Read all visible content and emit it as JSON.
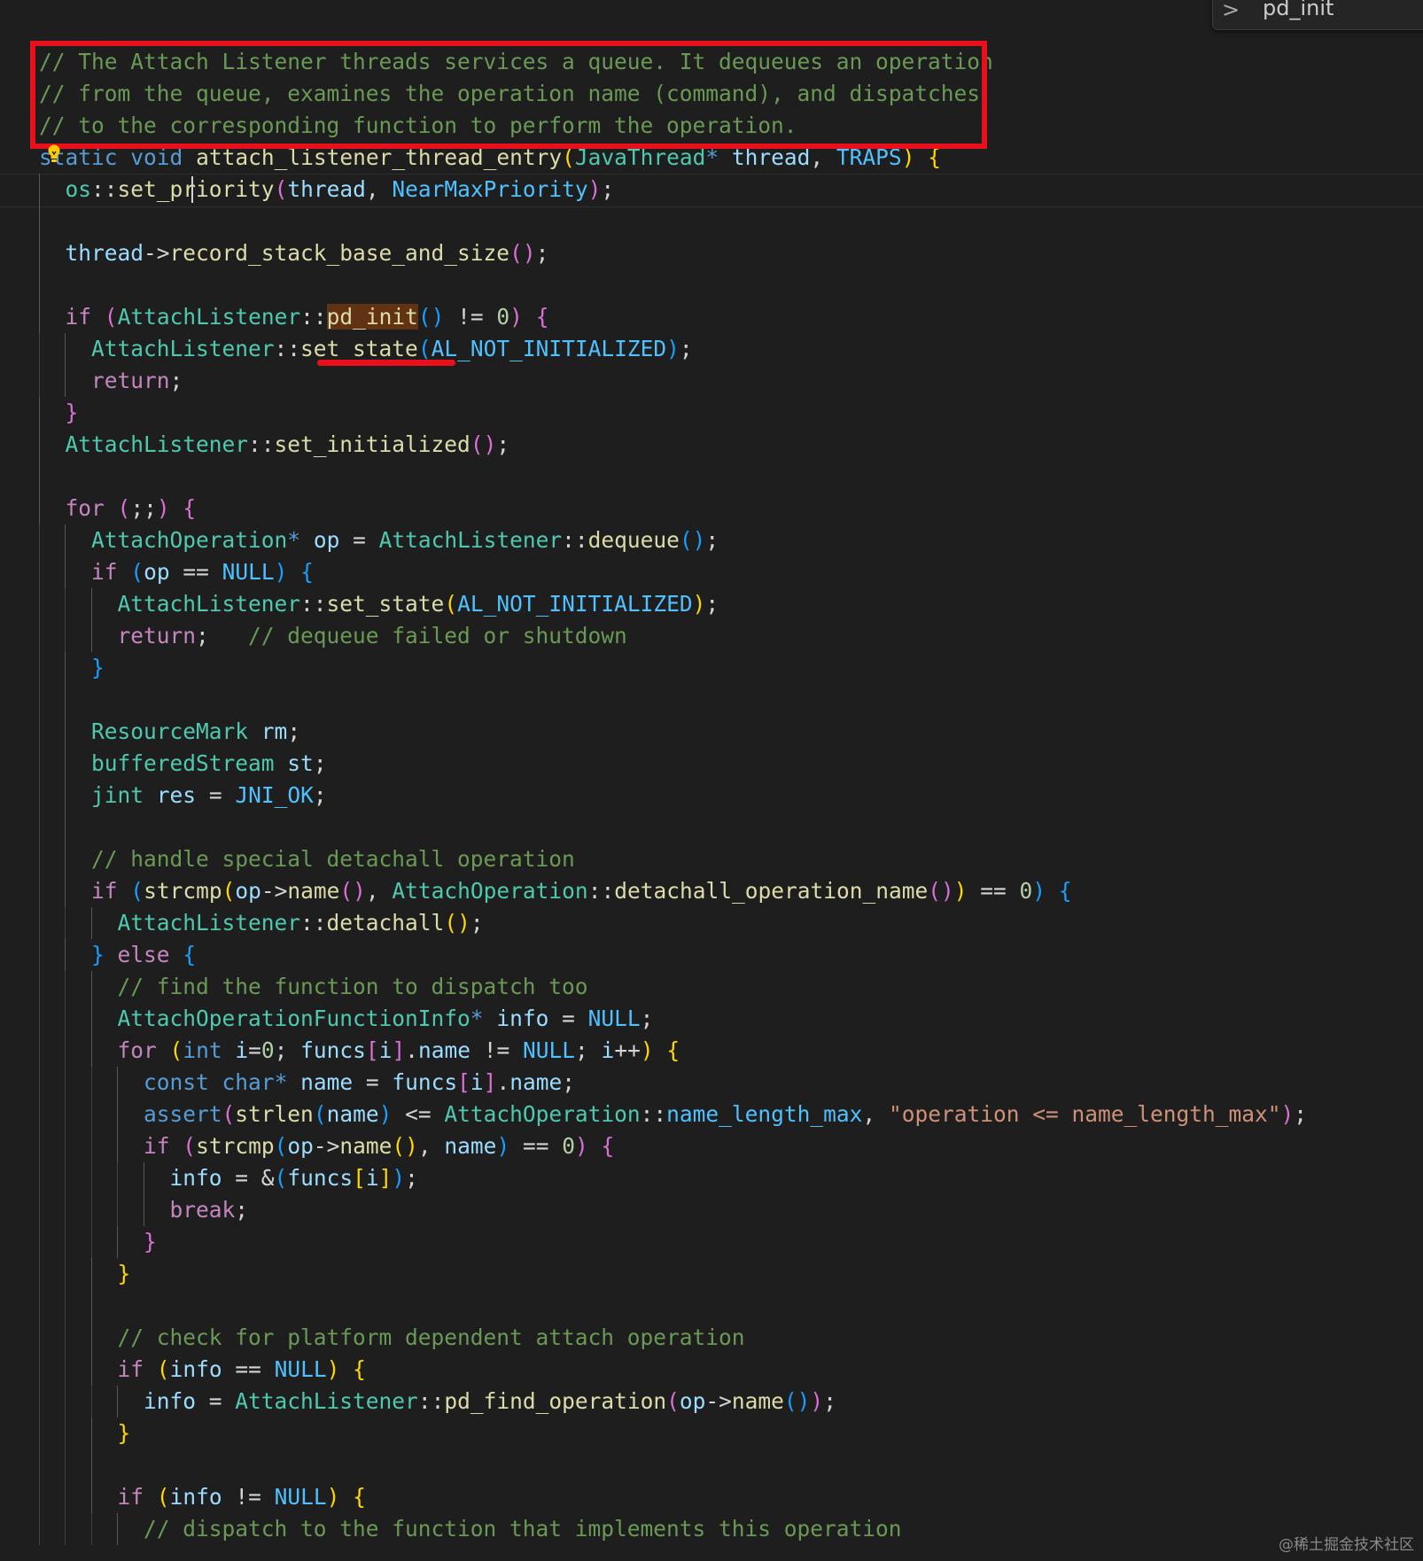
{
  "find_widget": {
    "search_term": "pd_init",
    "chevron": ">"
  },
  "watermark": "@稀土掘金技术社区",
  "annotation_colors": {
    "box": "#e8101a",
    "underline": "#e8101a"
  },
  "code_lines": [
    "// The Attach Listener threads services a queue. It dequeues an operation",
    "// from the queue, examines the operation name (command), and dispatches",
    "// to the corresponding function to perform the operation.",
    "static void attach_listener_thread_entry(JavaThread* thread, TRAPS) {",
    "  os::set_priority(thread, NearMaxPriority);",
    "",
    "  thread->record_stack_base_and_size();",
    "",
    "  if (AttachListener::pd_init() != 0) {",
    "    AttachListener::set_state(AL_NOT_INITIALIZED);",
    "    return;",
    "  }",
    "  AttachListener::set_initialized();",
    "",
    "  for (;;) {",
    "    AttachOperation* op = AttachListener::dequeue();",
    "    if (op == NULL) {",
    "      AttachListener::set_state(AL_NOT_INITIALIZED);",
    "      return;   // dequeue failed or shutdown",
    "    }",
    "",
    "    ResourceMark rm;",
    "    bufferedStream st;",
    "    jint res = JNI_OK;",
    "",
    "    // handle special detachall operation",
    "    if (strcmp(op->name(), AttachOperation::detachall_operation_name()) == 0) {",
    "      AttachListener::detachall();",
    "    } else {",
    "      // find the function to dispatch too",
    "      AttachOperationFunctionInfo* info = NULL;",
    "      for (int i=0; funcs[i].name != NULL; i++) {",
    "        const char* name = funcs[i].name;",
    "        assert(strlen(name) <= AttachOperation::name_length_max, \"operation <= name_length_max\");",
    "        if (strcmp(op->name(), name) == 0) {",
    "          info = &(funcs[i]);",
    "          break;",
    "        }",
    "      }",
    "",
    "      // check for platform dependent attach operation",
    "      if (info == NULL) {",
    "        info = AttachListener::pd_find_operation(op->name());",
    "      }",
    "",
    "      if (info != NULL) {",
    "        // dispatch to the function that implements this operation"
  ],
  "tokens": [
    [
      [
        "c",
        "// The Attach Listener threads services a queue. It dequeues an operation"
      ]
    ],
    [
      [
        "c",
        "// from the queue, examines the operation name (command), and dispatches"
      ]
    ],
    [
      [
        "c",
        "// to the corresponding function to perform the operation."
      ]
    ],
    [
      [
        "k",
        "static"
      ],
      [
        "p",
        " "
      ],
      [
        "k",
        "void"
      ],
      [
        "p",
        " "
      ],
      [
        "f",
        "attach_listener_thread_entry"
      ],
      [
        "b1",
        "("
      ],
      [
        "t",
        "JavaThread"
      ],
      [
        "k",
        "*"
      ],
      [
        "p",
        " "
      ],
      [
        "v",
        "thread"
      ],
      [
        "p",
        ", "
      ],
      [
        "cn",
        "TRAPS"
      ],
      [
        "b1",
        ")"
      ],
      [
        "p",
        " "
      ],
      [
        "b1",
        "{"
      ]
    ],
    [
      [
        "p",
        "  "
      ],
      [
        "t",
        "os"
      ],
      [
        "p",
        "::"
      ],
      [
        "f",
        "set_priority"
      ],
      [
        "b2",
        "("
      ],
      [
        "v",
        "thread"
      ],
      [
        "p",
        ", "
      ],
      [
        "cn",
        "NearMaxPriority"
      ],
      [
        "b2",
        ")"
      ],
      [
        "p",
        ";"
      ]
    ],
    [],
    [
      [
        "p",
        "  "
      ],
      [
        "v",
        "thread"
      ],
      [
        "p",
        "->"
      ],
      [
        "f",
        "record_stack_base_and_size"
      ],
      [
        "b2",
        "()"
      ],
      [
        "p",
        ";"
      ]
    ],
    [],
    [
      [
        "p",
        "  "
      ],
      [
        "kc",
        "if"
      ],
      [
        "p",
        " "
      ],
      [
        "b2",
        "("
      ],
      [
        "t",
        "AttachListener"
      ],
      [
        "p",
        "::"
      ],
      [
        "fh",
        "pd_init"
      ],
      [
        "b3",
        "()"
      ],
      [
        "p",
        " != "
      ],
      [
        "n",
        "0"
      ],
      [
        "b2",
        ")"
      ],
      [
        "p",
        " "
      ],
      [
        "b2",
        "{"
      ]
    ],
    [
      [
        "p",
        "    "
      ],
      [
        "t",
        "AttachListener"
      ],
      [
        "p",
        "::"
      ],
      [
        "f",
        "set_state"
      ],
      [
        "b3",
        "("
      ],
      [
        "cn",
        "AL_NOT_INITIALIZED"
      ],
      [
        "b3",
        ")"
      ],
      [
        "p",
        ";"
      ]
    ],
    [
      [
        "p",
        "    "
      ],
      [
        "kc",
        "return"
      ],
      [
        "p",
        ";"
      ]
    ],
    [
      [
        "p",
        "  "
      ],
      [
        "b2",
        "}"
      ]
    ],
    [
      [
        "p",
        "  "
      ],
      [
        "t",
        "AttachListener"
      ],
      [
        "p",
        "::"
      ],
      [
        "f",
        "set_initialized"
      ],
      [
        "b2",
        "()"
      ],
      [
        "p",
        ";"
      ]
    ],
    [],
    [
      [
        "p",
        "  "
      ],
      [
        "kc",
        "for"
      ],
      [
        "p",
        " "
      ],
      [
        "b2",
        "("
      ],
      [
        "p",
        ";;"
      ],
      [
        "b2",
        ")"
      ],
      [
        "p",
        " "
      ],
      [
        "b2",
        "{"
      ]
    ],
    [
      [
        "p",
        "    "
      ],
      [
        "t",
        "AttachOperation"
      ],
      [
        "k",
        "*"
      ],
      [
        "p",
        " "
      ],
      [
        "v",
        "op"
      ],
      [
        "p",
        " = "
      ],
      [
        "t",
        "AttachListener"
      ],
      [
        "p",
        "::"
      ],
      [
        "f",
        "dequeue"
      ],
      [
        "b3",
        "()"
      ],
      [
        "p",
        ";"
      ]
    ],
    [
      [
        "p",
        "    "
      ],
      [
        "kc",
        "if"
      ],
      [
        "p",
        " "
      ],
      [
        "b3",
        "("
      ],
      [
        "v",
        "op"
      ],
      [
        "p",
        " == "
      ],
      [
        "cn",
        "NULL"
      ],
      [
        "b3",
        ")"
      ],
      [
        "p",
        " "
      ],
      [
        "b3",
        "{"
      ]
    ],
    [
      [
        "p",
        "      "
      ],
      [
        "t",
        "AttachListener"
      ],
      [
        "p",
        "::"
      ],
      [
        "f",
        "set_state"
      ],
      [
        "b1",
        "("
      ],
      [
        "cn",
        "AL_NOT_INITIALIZED"
      ],
      [
        "b1",
        ")"
      ],
      [
        "p",
        ";"
      ]
    ],
    [
      [
        "p",
        "      "
      ],
      [
        "kc",
        "return"
      ],
      [
        "p",
        ";   "
      ],
      [
        "c",
        "// dequeue failed or shutdown"
      ]
    ],
    [
      [
        "p",
        "    "
      ],
      [
        "b3",
        "}"
      ]
    ],
    [],
    [
      [
        "p",
        "    "
      ],
      [
        "t",
        "ResourceMark"
      ],
      [
        "p",
        " "
      ],
      [
        "v",
        "rm"
      ],
      [
        "p",
        ";"
      ]
    ],
    [
      [
        "p",
        "    "
      ],
      [
        "t",
        "bufferedStream"
      ],
      [
        "p",
        " "
      ],
      [
        "v",
        "st"
      ],
      [
        "p",
        ";"
      ]
    ],
    [
      [
        "p",
        "    "
      ],
      [
        "t",
        "jint"
      ],
      [
        "p",
        " "
      ],
      [
        "v",
        "res"
      ],
      [
        "p",
        " = "
      ],
      [
        "cn",
        "JNI_OK"
      ],
      [
        "p",
        ";"
      ]
    ],
    [],
    [
      [
        "p",
        "    "
      ],
      [
        "c",
        "// handle special detachall operation"
      ]
    ],
    [
      [
        "p",
        "    "
      ],
      [
        "kc",
        "if"
      ],
      [
        "p",
        " "
      ],
      [
        "b3",
        "("
      ],
      [
        "f",
        "strcmp"
      ],
      [
        "b1",
        "("
      ],
      [
        "v",
        "op"
      ],
      [
        "p",
        "->"
      ],
      [
        "f",
        "name"
      ],
      [
        "b2",
        "()"
      ],
      [
        "p",
        ", "
      ],
      [
        "t",
        "AttachOperation"
      ],
      [
        "p",
        "::"
      ],
      [
        "f",
        "detachall_operation_name"
      ],
      [
        "b2",
        "()"
      ],
      [
        "b1",
        ")"
      ],
      [
        "p",
        " == "
      ],
      [
        "n",
        "0"
      ],
      [
        "b3",
        ")"
      ],
      [
        "p",
        " "
      ],
      [
        "b3",
        "{"
      ]
    ],
    [
      [
        "p",
        "      "
      ],
      [
        "t",
        "AttachListener"
      ],
      [
        "p",
        "::"
      ],
      [
        "f",
        "detachall"
      ],
      [
        "b1",
        "()"
      ],
      [
        "p",
        ";"
      ]
    ],
    [
      [
        "p",
        "    "
      ],
      [
        "b3",
        "}"
      ],
      [
        "p",
        " "
      ],
      [
        "kc",
        "else"
      ],
      [
        "p",
        " "
      ],
      [
        "b3",
        "{"
      ]
    ],
    [
      [
        "p",
        "      "
      ],
      [
        "c",
        "// find the function to dispatch too"
      ]
    ],
    [
      [
        "p",
        "      "
      ],
      [
        "t",
        "AttachOperationFunctionInfo"
      ],
      [
        "k",
        "*"
      ],
      [
        "p",
        " "
      ],
      [
        "v",
        "info"
      ],
      [
        "p",
        " = "
      ],
      [
        "cn",
        "NULL"
      ],
      [
        "p",
        ";"
      ]
    ],
    [
      [
        "p",
        "      "
      ],
      [
        "kc",
        "for"
      ],
      [
        "p",
        " "
      ],
      [
        "b1",
        "("
      ],
      [
        "k",
        "int"
      ],
      [
        "p",
        " "
      ],
      [
        "v",
        "i"
      ],
      [
        "p",
        "="
      ],
      [
        "n",
        "0"
      ],
      [
        "p",
        "; "
      ],
      [
        "v",
        "funcs"
      ],
      [
        "b2",
        "["
      ],
      [
        "v",
        "i"
      ],
      [
        "b2",
        "]"
      ],
      [
        "p",
        "."
      ],
      [
        "v",
        "name"
      ],
      [
        "p",
        " != "
      ],
      [
        "cn",
        "NULL"
      ],
      [
        "p",
        "; "
      ],
      [
        "v",
        "i"
      ],
      [
        "p",
        "++"
      ],
      [
        "b1",
        ")"
      ],
      [
        "p",
        " "
      ],
      [
        "b1",
        "{"
      ]
    ],
    [
      [
        "p",
        "        "
      ],
      [
        "k",
        "const"
      ],
      [
        "p",
        " "
      ],
      [
        "k",
        "char"
      ],
      [
        "k",
        "*"
      ],
      [
        "p",
        " "
      ],
      [
        "v",
        "name"
      ],
      [
        "p",
        " = "
      ],
      [
        "v",
        "funcs"
      ],
      [
        "b2",
        "["
      ],
      [
        "v",
        "i"
      ],
      [
        "b2",
        "]"
      ],
      [
        "p",
        "."
      ],
      [
        "v",
        "name"
      ],
      [
        "p",
        ";"
      ]
    ],
    [
      [
        "p",
        "        "
      ],
      [
        "k",
        "assert"
      ],
      [
        "b2",
        "("
      ],
      [
        "f",
        "strlen"
      ],
      [
        "b3",
        "("
      ],
      [
        "v",
        "name"
      ],
      [
        "b3",
        ")"
      ],
      [
        "p",
        " <= "
      ],
      [
        "t",
        "AttachOperation"
      ],
      [
        "p",
        "::"
      ],
      [
        "cn",
        "name_length_max"
      ],
      [
        "p",
        ", "
      ],
      [
        "s",
        "\"operation <= name_length_max\""
      ],
      [
        "b2",
        ")"
      ],
      [
        "p",
        ";"
      ]
    ],
    [
      [
        "p",
        "        "
      ],
      [
        "kc",
        "if"
      ],
      [
        "p",
        " "
      ],
      [
        "b2",
        "("
      ],
      [
        "f",
        "strcmp"
      ],
      [
        "b3",
        "("
      ],
      [
        "v",
        "op"
      ],
      [
        "p",
        "->"
      ],
      [
        "f",
        "name"
      ],
      [
        "b1",
        "()"
      ],
      [
        "p",
        ", "
      ],
      [
        "v",
        "name"
      ],
      [
        "b3",
        ")"
      ],
      [
        "p",
        " == "
      ],
      [
        "n",
        "0"
      ],
      [
        "b2",
        ")"
      ],
      [
        "p",
        " "
      ],
      [
        "b2",
        "{"
      ]
    ],
    [
      [
        "p",
        "          "
      ],
      [
        "v",
        "info"
      ],
      [
        "p",
        " = &"
      ],
      [
        "b3",
        "("
      ],
      [
        "v",
        "funcs"
      ],
      [
        "b1",
        "["
      ],
      [
        "v",
        "i"
      ],
      [
        "b1",
        "]"
      ],
      [
        "b3",
        ")"
      ],
      [
        "p",
        ";"
      ]
    ],
    [
      [
        "p",
        "          "
      ],
      [
        "kc",
        "break"
      ],
      [
        "p",
        ";"
      ]
    ],
    [
      [
        "p",
        "        "
      ],
      [
        "b2",
        "}"
      ]
    ],
    [
      [
        "p",
        "      "
      ],
      [
        "b1",
        "}"
      ]
    ],
    [],
    [
      [
        "p",
        "      "
      ],
      [
        "c",
        "// check for platform dependent attach operation"
      ]
    ],
    [
      [
        "p",
        "      "
      ],
      [
        "kc",
        "if"
      ],
      [
        "p",
        " "
      ],
      [
        "b1",
        "("
      ],
      [
        "v",
        "info"
      ],
      [
        "p",
        " == "
      ],
      [
        "cn",
        "NULL"
      ],
      [
        "b1",
        ")"
      ],
      [
        "p",
        " "
      ],
      [
        "b1",
        "{"
      ]
    ],
    [
      [
        "p",
        "        "
      ],
      [
        "v",
        "info"
      ],
      [
        "p",
        " = "
      ],
      [
        "t",
        "AttachListener"
      ],
      [
        "p",
        "::"
      ],
      [
        "f",
        "pd_find_operation"
      ],
      [
        "b2",
        "("
      ],
      [
        "v",
        "op"
      ],
      [
        "p",
        "->"
      ],
      [
        "f",
        "name"
      ],
      [
        "b3",
        "()"
      ],
      [
        "b2",
        ")"
      ],
      [
        "p",
        ";"
      ]
    ],
    [
      [
        "p",
        "      "
      ],
      [
        "b1",
        "}"
      ]
    ],
    [],
    [
      [
        "p",
        "      "
      ],
      [
        "kc",
        "if"
      ],
      [
        "p",
        " "
      ],
      [
        "b1",
        "("
      ],
      [
        "v",
        "info"
      ],
      [
        "p",
        " != "
      ],
      [
        "cn",
        "NULL"
      ],
      [
        "b1",
        ")"
      ],
      [
        "p",
        " "
      ],
      [
        "b1",
        "{"
      ]
    ],
    [
      [
        "p",
        "        "
      ],
      [
        "c",
        "// dispatch to the function that implements this operation"
      ]
    ]
  ]
}
